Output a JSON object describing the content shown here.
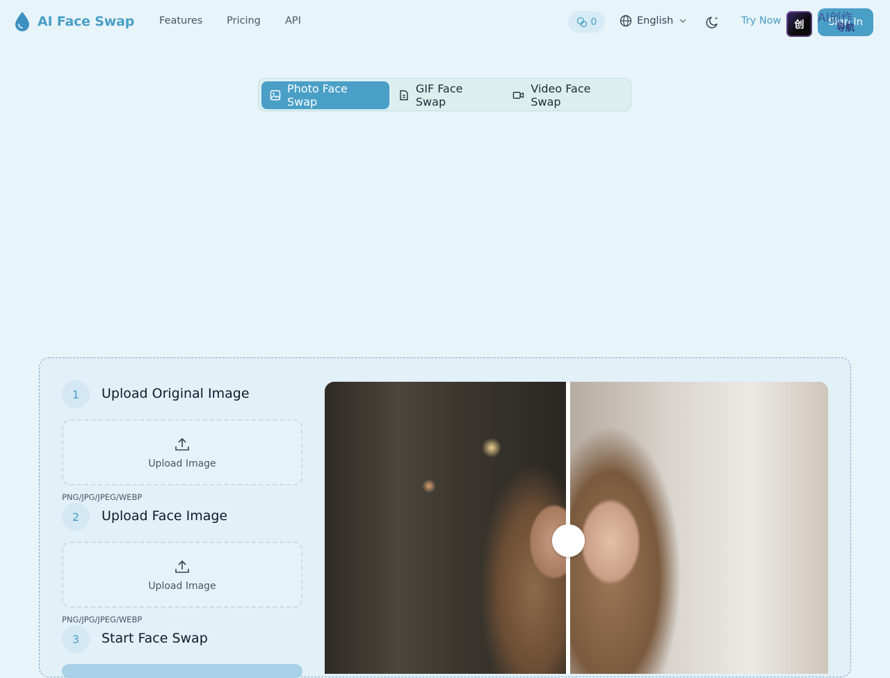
{
  "header": {
    "logo_text": "AI Face Swap",
    "nav": [
      "Features",
      "Pricing",
      "API"
    ],
    "credits": "0",
    "language": "English",
    "try_now": "Try Now",
    "sign_in": "Sign In",
    "badge_icon_text": "创",
    "badge_text": "AI创作",
    "badge_sub": "导航"
  },
  "tabs": [
    {
      "label": "Photo Face Swap",
      "icon": "image-icon",
      "active": true
    },
    {
      "label": "GIF Face Swap",
      "icon": "file-gif-icon",
      "active": false
    },
    {
      "label": "Video Face Swap",
      "icon": "video-icon",
      "active": false
    }
  ],
  "steps": [
    {
      "num": "1",
      "title": "Upload Original Image",
      "upload_label": "Upload Image",
      "formats": "PNG/JPG/JPEG/WEBP"
    },
    {
      "num": "2",
      "title": "Upload Face Image",
      "upload_label": "Upload Image",
      "formats": "PNG/JPG/JPEG/WEBP"
    },
    {
      "num": "3",
      "title": "Start Face Swap"
    }
  ],
  "compare": {
    "divider_position": 0.48
  },
  "colors": {
    "accent": "#4a9fc7",
    "background": "#e7f4fa",
    "panel": "#e2f0f7"
  }
}
